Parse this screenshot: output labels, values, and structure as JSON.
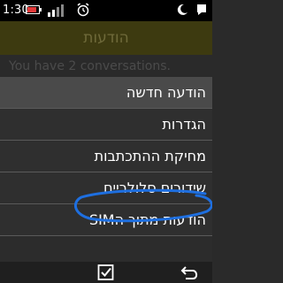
{
  "status_bar": {
    "time": "1:30",
    "icons": [
      "battery-charging-icon",
      "signal-icon",
      "alarm-icon",
      "moon-icon",
      "notification-icon"
    ]
  },
  "background_app": {
    "title": "הודעות",
    "body_text": "You have 2 conversations."
  },
  "menu": {
    "items": [
      {
        "label": "הודעה חדשה",
        "selected": true
      },
      {
        "label": "הגדרות",
        "selected": false
      },
      {
        "label": "מחיקת ההתכתבות",
        "selected": false
      },
      {
        "label": "שידורים סלולריים",
        "selected": false
      },
      {
        "label": "הודעות מתוך הSIM",
        "selected": false
      }
    ]
  },
  "softkeys": {
    "right_icon": "checkbox-icon",
    "left_icon": "back-arrow-icon"
  },
  "colors": {
    "selected_row": "#4a4a4a",
    "row": "#2f2f2f",
    "header_dim": "#3d3a10",
    "annotation_ink": "#1e6fe0"
  }
}
